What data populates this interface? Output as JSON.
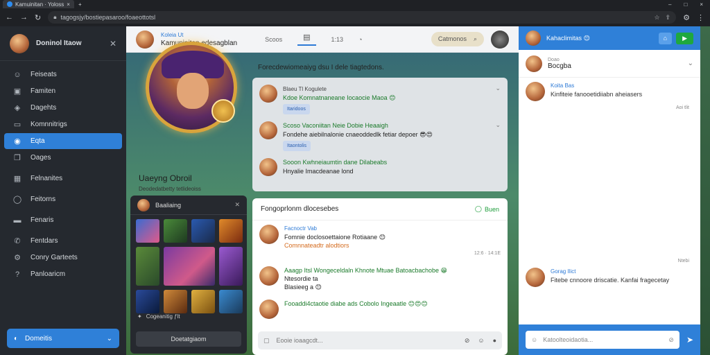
{
  "browser": {
    "tab_title": "Kamuinitan · Yoloss",
    "url": "tagogsjy/bostiepasaroo/foaeottotsl"
  },
  "sidebar": {
    "user_name": "Doninol Itaow",
    "items": [
      {
        "label": "Feiseats",
        "icon": "people-icon"
      },
      {
        "label": "Famiten",
        "icon": "image-icon"
      },
      {
        "label": "Dagehts",
        "icon": "tag-icon"
      },
      {
        "label": "Komnnitrigs",
        "icon": "chat-icon"
      },
      {
        "label": "Eqta",
        "icon": "globe-icon",
        "active": true
      },
      {
        "label": "Oages",
        "icon": "pages-icon"
      },
      {
        "label": "Felnanites",
        "icon": "grid-icon"
      },
      {
        "label": "Feitorns",
        "icon": "circle-icon"
      },
      {
        "label": "Fenaris",
        "icon": "folder-icon"
      },
      {
        "label": "Fentdars",
        "icon": "phone-icon"
      },
      {
        "label": "Conry Garteets",
        "icon": "gear-icon"
      },
      {
        "label": "Panloaricm",
        "icon": "help-icon"
      }
    ],
    "bottom_label": "Domeitis"
  },
  "topbar": {
    "subtitle": "Koleia Ut",
    "title": "Kamuninitan edesagblan",
    "tab_label": "Scoos",
    "tab_count": "1:13",
    "pill_label": "Catmonos"
  },
  "profile": {
    "name": "Uaeyng Obroil",
    "stats": "Deodedatbetty tetlideoiss"
  },
  "heroes": {
    "title": "Baaliaing",
    "footer": "Cogeanitig ƒlt",
    "button": "Doetatgiaom"
  },
  "feed": {
    "heading": "Forecdewiomeaiyg dsu I dele tiagtedons.",
    "posts": [
      {
        "user": "Blaeu Tl Kogulete",
        "text": "Kdoe Komnatnaneane Iocaocie Maoa 😊",
        "chip": "Itaridoos"
      },
      {
        "user": "Scoso Vaconiitan Neie Dobie Heaaigh",
        "text": "Fondehe aiebilnalonie cnaeoddedlk fetiar depoer 😎😍",
        "chip": "Itaontolis",
        "dark": false
      },
      {
        "user": "Sooon Kwhneiaumtin dane Dilabeabs",
        "text": "Hnyalie Imacdeanae lond"
      }
    ]
  },
  "chat": {
    "title": "Fongoprlonm dlocesebes",
    "action": "Buen",
    "messages": [
      {
        "user": "Facnoctr Vab",
        "line1": "Fomnie doclosoettaione Rotiaane 😊",
        "line2": "Comnnateadtr alodtiors",
        "time": "12:6 · 14:1E"
      },
      {
        "user": "Aaagp Itsl Wongeceldaln Khnote Mtuae Batoacbachobe 😁",
        "line1": "Ntesordie ta",
        "line2": "Blasieeg a 😊",
        "time": ""
      },
      {
        "user": "Fooaddi4ctaotie diabe ads Cobolo Ingeaatle 😊😍😊",
        "line1": "",
        "line2": "",
        "time": ""
      }
    ],
    "composer_placeholder": "Eooie ioaagcdt..."
  },
  "right": {
    "title": "Kahaclimitas 😊",
    "user_label": "Doao",
    "user_value": "Bocgba",
    "msg1_user": "Koita Bas",
    "msg1_text": "Kinfiteie fanooetidiiabn aheiasers",
    "msg1_time": "Aoi tlit",
    "mid_time": "Ntebi",
    "msg2_user": "Gorag Ilict",
    "msg2_text": "Fitebe cnnoore driscatie. Kanfai fragecetay",
    "input_placeholder": "Katoolteoidaotia..."
  }
}
